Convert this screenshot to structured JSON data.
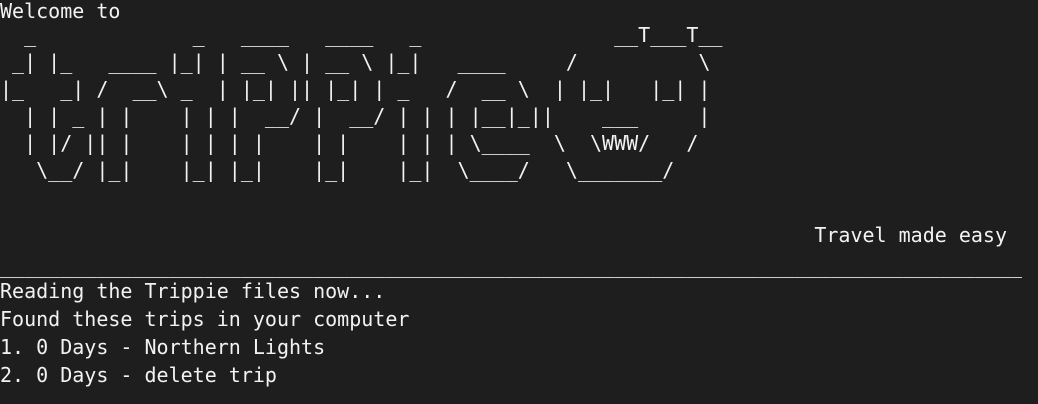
{
  "terminal": {
    "welcome": "Welcome to",
    "logo_ascii": "  _             _   ____   ____   _                __T___T__\n _| |_   ____ |_| | __ \\ | __ \\ |_|   ____     /          \\\n|_   _| /  __\\ _  | |_| || |_| | _   /  __ \\  | |_|   |_| |\n  | | _ | |    | | |  __/ |  __/ | | | |__|_||    ___     |\n  | |/ || |    | | | |    | |    | | | \\____  \\  \\WWW/   /\n   \\__/ |_|    |_| |_|    |_|    |_|  \\____/   \\_______/",
    "tagline": "Travel made easy",
    "divider": "________________________________________________________________________________________________________________________",
    "output": [
      "Reading the Trippie files now...",
      "Found these trips in your computer"
    ],
    "trips": [
      "1. 0 Days - Northern Lights",
      "2. 0 Days - delete trip"
    ]
  }
}
